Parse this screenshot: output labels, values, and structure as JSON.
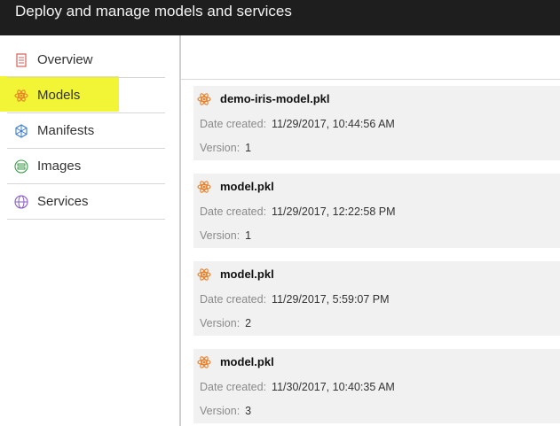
{
  "window": {
    "title": "Deploy and manage models and services"
  },
  "sidebar": {
    "items": [
      {
        "label": "Overview",
        "icon": "document-icon"
      },
      {
        "label": "Models",
        "icon": "atom-icon",
        "selected": true
      },
      {
        "label": "Manifests",
        "icon": "cube-network-icon"
      },
      {
        "label": "Images",
        "icon": "image-stack-icon"
      },
      {
        "label": "Services",
        "icon": "globe-icon"
      }
    ]
  },
  "models": [
    {
      "name": "demo-iris-model.pkl",
      "date_label": "Date created:",
      "date": "11/29/2017, 10:44:56 AM",
      "version_label": "Version:",
      "version": "1"
    },
    {
      "name": "model.pkl",
      "date_label": "Date created:",
      "date": "11/29/2017, 12:22:58 PM",
      "version_label": "Version:",
      "version": "1"
    },
    {
      "name": "model.pkl",
      "date_label": "Date created:",
      "date": "11/29/2017, 5:59:07 PM",
      "version_label": "Version:",
      "version": "2"
    },
    {
      "name": "model.pkl",
      "date_label": "Date created:",
      "date": "11/30/2017, 10:40:35 AM",
      "version_label": "Version:",
      "version": "3"
    }
  ],
  "colors": {
    "titlebar": "#1e1e1e",
    "highlight": "#f2f536",
    "accent_orange": "#e8812a"
  }
}
